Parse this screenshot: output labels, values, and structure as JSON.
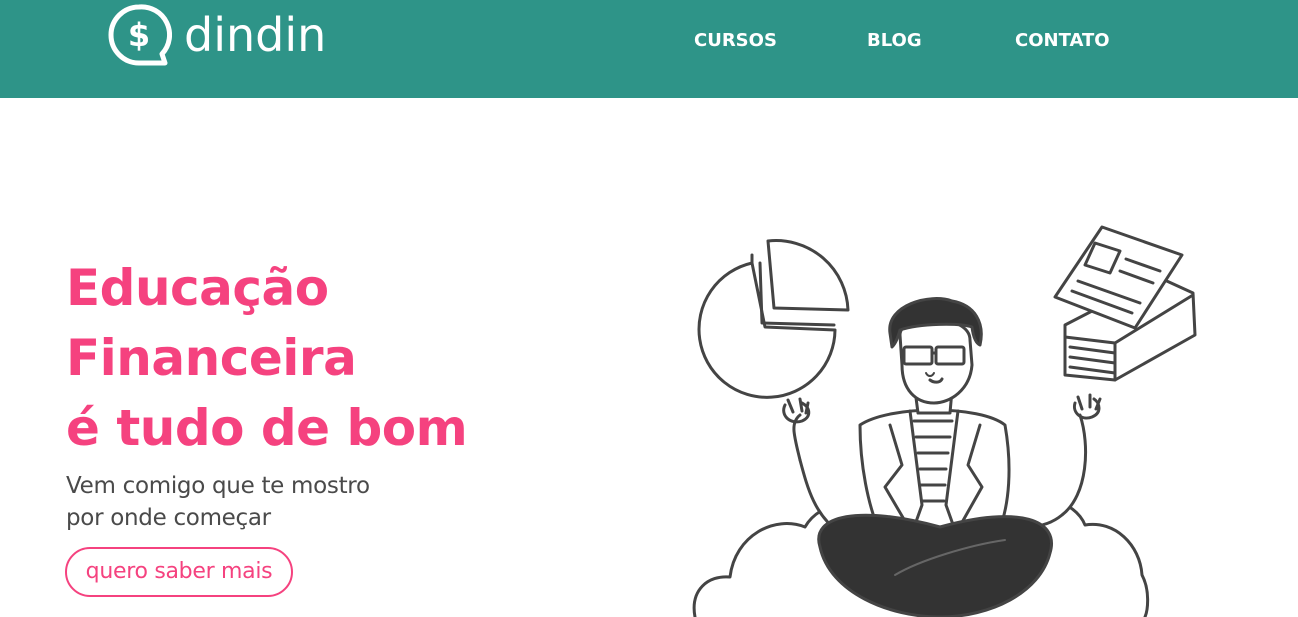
{
  "header": {
    "logo_text": "dindin",
    "logo_icon": "dollar-speech-bubble-icon",
    "background_color": "#2e9488",
    "nav": [
      {
        "label": "CURSOS"
      },
      {
        "label": "BLOG"
      },
      {
        "label": "CONTATO"
      }
    ]
  },
  "hero": {
    "title_lines": [
      "Educação",
      "Financeira",
      "é tudo de bom"
    ],
    "subtitle_lines": [
      "Vem comigo que te mostro",
      "por onde começar"
    ],
    "cta_label": "quero saber mais",
    "accent_color": "#f5427f",
    "text_color": "#4a4a4a",
    "illustration": "meditating-person-with-pie-chart-and-documents"
  }
}
